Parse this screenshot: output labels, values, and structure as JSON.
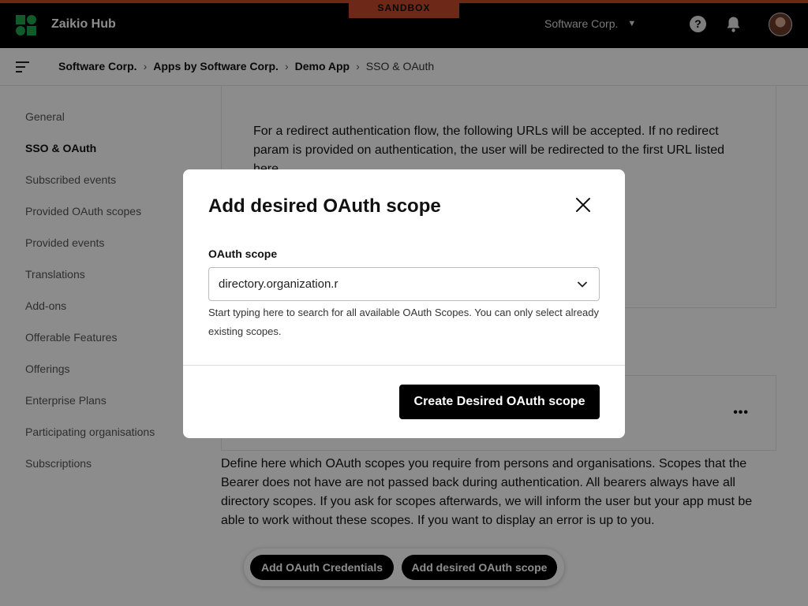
{
  "header": {
    "app_name": "Zaikio Hub",
    "env_badge": "SANDBOX",
    "org_switcher": "Software Corp.",
    "org_caret": "▼",
    "help_glyph": "?",
    "icons": {
      "logo": "zaikio-logo",
      "help": "help-icon",
      "notifications": "bell-icon",
      "avatar": "user-avatar"
    },
    "colors": {
      "accent": "#c94a2a",
      "brand_green": "#1fa44b"
    }
  },
  "breadcrumb": {
    "items": [
      "Software Corp.",
      "Apps by Software Corp.",
      "Demo App",
      "SSO & OAuth"
    ],
    "separator": "›"
  },
  "sidebar": {
    "items": [
      {
        "label": "General"
      },
      {
        "label": "SSO & OAuth",
        "active": true
      },
      {
        "label": "Subscribed events"
      },
      {
        "label": "Provided OAuth scopes"
      },
      {
        "label": "Provided events"
      },
      {
        "label": "Translations"
      },
      {
        "label": "Add-ons"
      },
      {
        "label": "Offerable Features"
      },
      {
        "label": "Offerings"
      },
      {
        "label": "Enterprise Plans"
      },
      {
        "label": "Participating organisations"
      },
      {
        "label": "Subscriptions"
      }
    ]
  },
  "main": {
    "redirect_text": "For a redirect authentication flow, the following URLs will be accepted. If no redirect param is provided on authentication, the user will be redirected to the first URL listed here.",
    "more_glyph": "•••",
    "scopes_description": "Define here which OAuth scopes you require from persons and organisations. Scopes that the Bearer does not have are not passed back during authentication. All bearers always have all directory scopes. If you ask for scopes afterwards, we will inform the user but your app must be able to work without these scopes. If you want to display an error is up to you."
  },
  "action_bar": {
    "add_credentials": "Add OAuth Credentials",
    "add_scope": "Add desired OAuth scope"
  },
  "modal": {
    "title": "Add desired OAuth scope",
    "field_label": "OAuth scope",
    "field_value": "directory.organization.r",
    "help_text": "Start typing here to search for all available OAuth Scopes. You can only select already existing scopes.",
    "submit_label": "Create Desired OAuth scope"
  }
}
